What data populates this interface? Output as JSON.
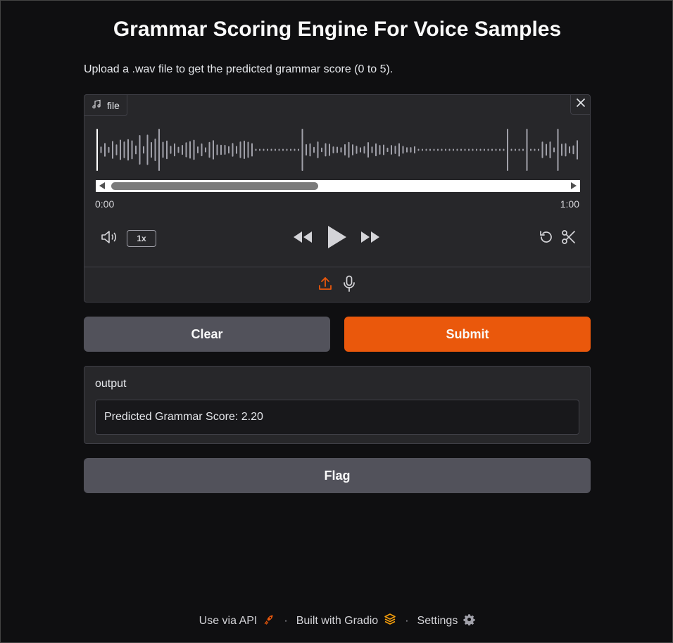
{
  "title": "Grammar Scoring Engine For Voice Samples",
  "description": "Upload a .wav file to get the predicted grammar score (0 to 5).",
  "audio": {
    "label": "file",
    "label_icon": "music-note-icon",
    "close_icon": "close-icon",
    "time_start": "0:00",
    "time_end": "1:00",
    "scroll_position": 0.0,
    "speed": "1x",
    "controls": {
      "volume_icon": "volume-icon",
      "rewind_icon": "rewind-icon",
      "play_icon": "play-icon",
      "forward_icon": "fast-forward-icon",
      "reset_icon": "undo-icon",
      "trim_icon": "scissors-icon"
    },
    "sources": {
      "upload_icon": "upload-icon",
      "microphone_icon": "microphone-icon"
    }
  },
  "buttons": {
    "clear": "Clear",
    "submit": "Submit",
    "flag": "Flag"
  },
  "output": {
    "label": "output",
    "value": "Predicted Grammar Score: 2.20"
  },
  "footer": {
    "api": "Use via API",
    "separator": "·",
    "built_with": "Built with Gradio",
    "settings": "Settings"
  },
  "colors": {
    "accent": "#ea580c",
    "background": "#0f0f11",
    "panel": "#27272a",
    "waveform": "#a1a1aa"
  }
}
